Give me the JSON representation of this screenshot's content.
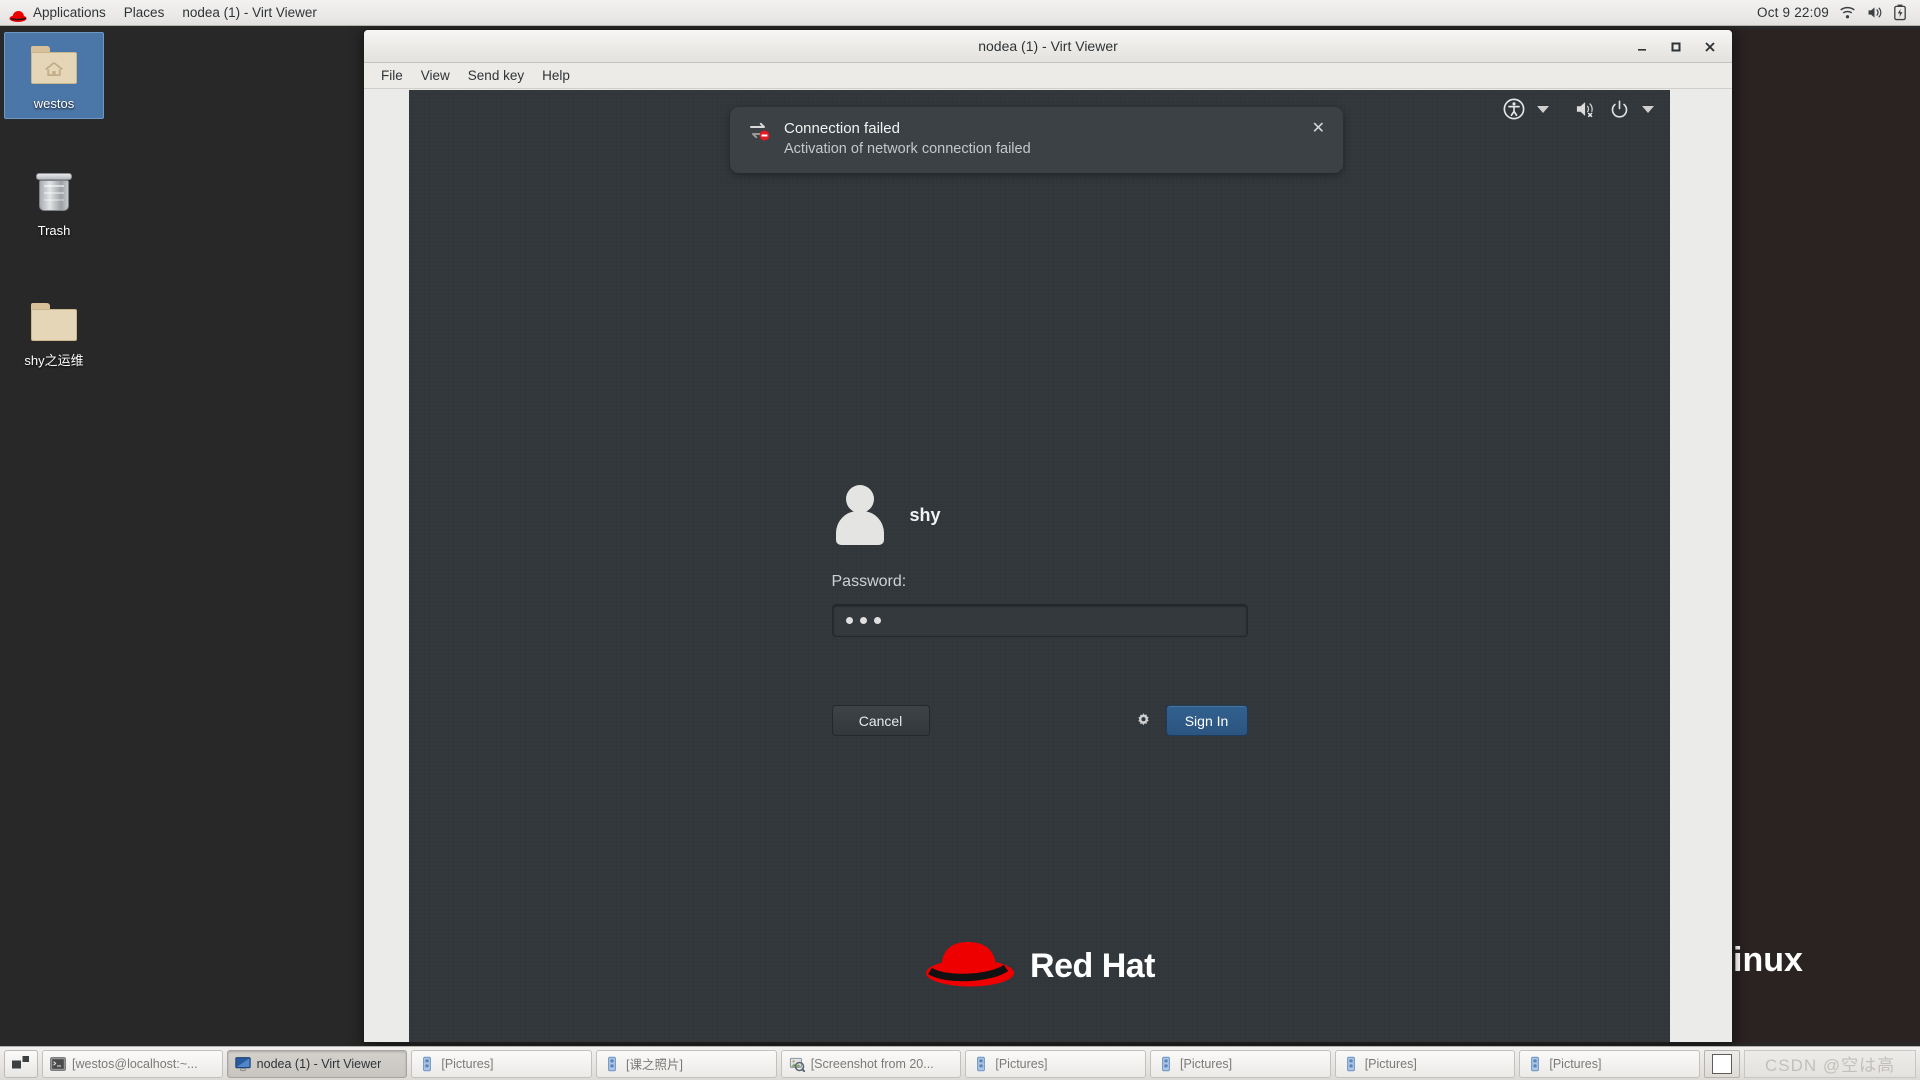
{
  "top_panel": {
    "logo_icon": "redhat-logo-icon",
    "menus": [
      {
        "label": "Applications",
        "name": "applications-menu"
      },
      {
        "label": "Places",
        "name": "places-menu"
      },
      {
        "label": "nodea (1) - Virt Viewer",
        "name": "active-window-menu"
      }
    ],
    "clock": "Oct 9  22:09",
    "indicators": [
      {
        "name": "wifi-icon"
      },
      {
        "name": "volume-icon"
      },
      {
        "name": "battery-icon"
      }
    ]
  },
  "desktop_icons": [
    {
      "label": "westos",
      "icon": "home-folder-icon",
      "selected": true
    },
    {
      "label": "Trash",
      "icon": "trash-icon",
      "selected": false
    },
    {
      "label": "shy之运维",
      "icon": "folder-icon",
      "selected": false
    }
  ],
  "virt_viewer": {
    "title": "nodea (1) - Virt Viewer",
    "window_buttons": {
      "minimize": "–",
      "maximize": "□",
      "close": "✕"
    },
    "menubar": [
      {
        "label": "File",
        "name": "menu-file"
      },
      {
        "label": "View",
        "name": "menu-view"
      },
      {
        "label": "Send key",
        "name": "menu-send-key"
      },
      {
        "label": "Help",
        "name": "menu-help"
      }
    ]
  },
  "vm_screen": {
    "top_controls": [
      {
        "name": "accessibility-icon"
      },
      {
        "name": "chevron-down-icon"
      },
      {
        "name": "volume-muted-icon"
      },
      {
        "name": "power-icon"
      },
      {
        "name": "chevron-down-icon"
      }
    ],
    "notification": {
      "icon": "network-error-icon",
      "title": "Connection failed",
      "body": "Activation of network connection failed",
      "close_label": "✕"
    },
    "login": {
      "avatar_icon": "user-avatar-icon",
      "username": "shy",
      "password_label": "Password:",
      "password_value": "•••",
      "password_dots": 3,
      "cancel_label": "Cancel",
      "settings_icon": "gear-icon",
      "signin_label": "Sign In"
    },
    "branding": {
      "logo_icon": "red-hat-fedora-icon",
      "text": "Red Hat"
    }
  },
  "background_window": {
    "visible_text": "inux"
  },
  "taskbar": {
    "workspace_switcher_icon": "workspace-switcher-icon",
    "items": [
      {
        "label": "[westos@localhost:~...",
        "icon": "terminal-icon",
        "active": false
      },
      {
        "label": "nodea (1) - Virt Viewer",
        "icon": "display-icon",
        "active": true
      },
      {
        "label": "[Pictures]",
        "icon": "file-manager-icon",
        "active": false
      },
      {
        "label": "[课之照片]",
        "icon": "file-manager-icon",
        "active": false
      },
      {
        "label": "[Screenshot from 20...",
        "icon": "image-viewer-icon",
        "active": false
      },
      {
        "label": "[Pictures]",
        "icon": "file-manager-icon",
        "active": false
      },
      {
        "label": "[Pictures]",
        "icon": "file-manager-icon",
        "active": false
      },
      {
        "label": "[Pictures]",
        "icon": "file-manager-icon",
        "active": false
      },
      {
        "label": "[Pictures]",
        "icon": "file-manager-icon",
        "active": false
      }
    ],
    "show_desktop_name": "show-desktop-button",
    "watermark": "CSDN @空は高"
  },
  "colors": {
    "panel_bg": "#eceae8",
    "vm_bg": "#31373b",
    "notification_bg": "#3b4145",
    "signin_blue": "#31618f",
    "selection_blue": "#4a76a8",
    "redhat_red": "#ee0000"
  }
}
